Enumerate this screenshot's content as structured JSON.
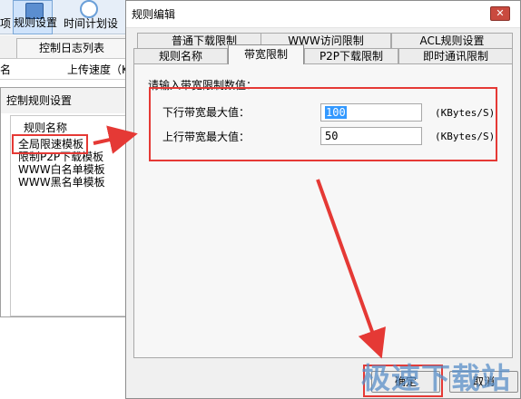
{
  "app": {
    "toolbar_left_fragment": "项",
    "toolbar_rules": "规则设置",
    "toolbar_plan": "时间计划设",
    "tab_log": "控制日志列表",
    "col_name_fragment": "名",
    "col_upload": "上传速度（K"
  },
  "control_dialog": {
    "title": "控制规则设置",
    "items": [
      "规则名称",
      "全局限速模板",
      "限制P2P下载模板",
      "WWW白名单模板",
      "WWW黑名单模板"
    ]
  },
  "rule_dialog": {
    "title": "规则编辑",
    "close_glyph": "✕",
    "tabs_row1": [
      "普通下载限制",
      "WWW访问限制",
      "ACL规则设置"
    ],
    "tabs_row2": [
      "规则名称",
      "带宽限制",
      "P2P下载限制",
      "即时通讯限制"
    ],
    "active_tab": "带宽限制",
    "prompt": "请输入带宽限制数值：",
    "download_label": "下行带宽最大值：",
    "download_value": "100",
    "upload_label": "上行带宽最大值：",
    "upload_value": "50",
    "unit": "(KBytes/S)",
    "ok_label": "确定",
    "cancel_label": "取消"
  },
  "watermark": "极速下载站",
  "colors": {
    "annotation_red": "#e53935",
    "selection_blue": "#3399ff",
    "close_button": "#c94a3f",
    "watermark_blue": "#5a8fc8"
  }
}
